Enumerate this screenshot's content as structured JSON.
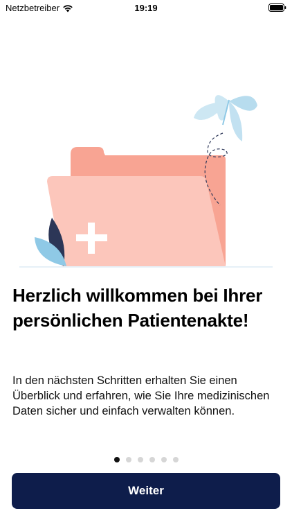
{
  "status_bar": {
    "carrier": "Netzbetreiber",
    "time": "19:19",
    "wifi_icon": "wifi-icon",
    "battery_icon": "battery-icon"
  },
  "illustration": {
    "folder_icon": "folder-with-medical-cross",
    "butterfly_icon": "butterfly-icon",
    "leaf_icon": "leaves-icon",
    "colors": {
      "folder_back": "#f8a493",
      "folder_front": "#fcc6bb",
      "cross": "#ffffff",
      "butterfly": "#cde7f3",
      "leaf_dark": "#2c3657",
      "leaf_light": "#8fc9e6"
    }
  },
  "onboarding": {
    "title": "Herzlich willkommen bei Ihrer persönlichen Patientenakte!",
    "body": "In den nächsten Schritten erhalten Sie einen Überblick und erfahren, wie Sie Ihre medizinischen Daten sicher und einfach verwalten können.",
    "pages_total": 6,
    "current_page": 1
  },
  "continue_button": {
    "label": "Weiter",
    "color": "#0e1d4b"
  }
}
